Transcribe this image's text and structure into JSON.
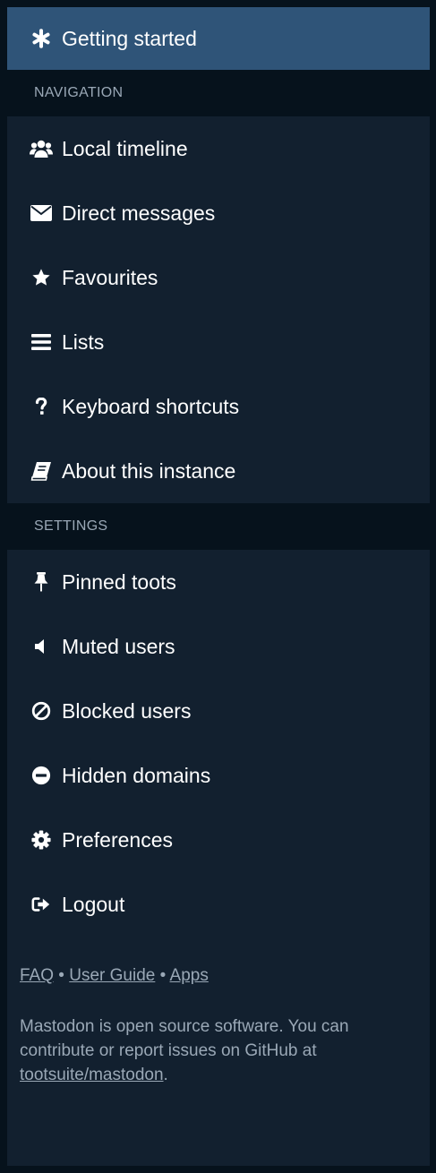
{
  "header": {
    "label": "Getting started",
    "icon": "asterisk-icon"
  },
  "navigation": {
    "title": "NAVIGATION",
    "items": [
      {
        "label": "Local timeline",
        "icon": "users-icon"
      },
      {
        "label": "Direct messages",
        "icon": "envelope-icon"
      },
      {
        "label": "Favourites",
        "icon": "star-icon"
      },
      {
        "label": "Lists",
        "icon": "bars-icon"
      },
      {
        "label": "Keyboard shortcuts",
        "icon": "question-icon"
      },
      {
        "label": "About this instance",
        "icon": "book-icon"
      }
    ]
  },
  "settings": {
    "title": "SETTINGS",
    "items": [
      {
        "label": "Pinned toots",
        "icon": "thumbtack-icon"
      },
      {
        "label": "Muted users",
        "icon": "volume-off-icon"
      },
      {
        "label": "Blocked users",
        "icon": "ban-icon"
      },
      {
        "label": "Hidden domains",
        "icon": "minus-circle-icon"
      },
      {
        "label": "Preferences",
        "icon": "cog-icon"
      },
      {
        "label": "Logout",
        "icon": "sign-out-icon"
      }
    ]
  },
  "footer": {
    "faq": "FAQ",
    "sep1": " • ",
    "user_guide": "User Guide",
    "sep2": " • ",
    "apps": "Apps",
    "about_text": "Mastodon is open source software. You can contribute or report issues on GitHub at ",
    "repo_link": "tootsuite/mastodon",
    "period": "."
  },
  "colors": {
    "background": "#06121c",
    "panel": "#12202f",
    "header_active": "#2f5478",
    "text": "#ffffff",
    "muted_text": "#9aa8b6"
  }
}
